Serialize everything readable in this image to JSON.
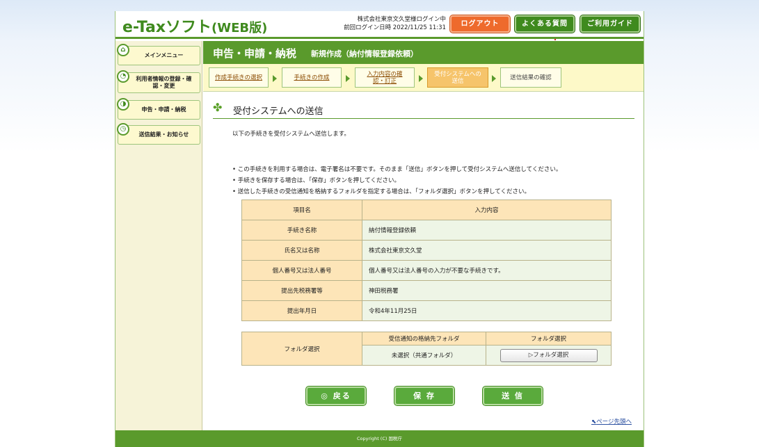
{
  "header": {
    "logo_main": "e-Taxソフト",
    "logo_version": "(WEB版)",
    "user_line": "株式会社東京文久堂様ログイン中",
    "last_login_label": "前回ログイン日時",
    "last_login_value": "2022/11/25 11:31",
    "logout_label": "ログアウト",
    "faq_label": "よくある質問",
    "guide_label": "ご利用ガイド"
  },
  "sidebar": {
    "items": [
      {
        "label": "メインメニュー",
        "icon": "home-icon"
      },
      {
        "label": "利用者情報の登録・確認・変更",
        "icon": "user-icon"
      },
      {
        "label": "申告・申請・納税",
        "icon": "document-icon"
      },
      {
        "label": "送信結果・お知らせ",
        "icon": "clock-icon"
      }
    ]
  },
  "page": {
    "title": "申告・申請・納税",
    "subtitle": "新規作成（納付情報登録依頼）"
  },
  "steps": [
    {
      "label": "作成手続きの選択"
    },
    {
      "label": "手続きの作成"
    },
    {
      "label": "入力内容の確認・訂正"
    },
    {
      "label": "受付システムへの送信"
    },
    {
      "label": "送信結果の確認"
    }
  ],
  "section": {
    "title": "受付システムへの送信",
    "intro": "以下の手続きを受付システムへ送信します。",
    "bullets": [
      "この手続きを利用する場合は、電子署名は不要です。そのまま「送信」ボタンを押して受付システムへ送信してください。",
      "手続きを保存する場合は、「保存」ボタンを押してください。",
      "送信した手続きの受信通知を格納するフォルダを指定する場合は、「フォルダ選択」ボタンを押してください。"
    ]
  },
  "info_table": {
    "header": {
      "key": "項目名",
      "value": "入力内容"
    },
    "rows": [
      {
        "key": "手続き名称",
        "value": "納付情報登録依頼"
      },
      {
        "key": "氏名又は名称",
        "value": "株式会社東京文久堂"
      },
      {
        "key": "個人番号又は法人番号",
        "value": "個人番号又は法人番号の入力が不要な手続きです。"
      },
      {
        "key": "提出先税務署等",
        "value": "神田税務署"
      },
      {
        "key": "提出年月日",
        "value": "令和4年11月25日"
      }
    ]
  },
  "folder_table": {
    "label": "フォルダ選択",
    "col_folder": "受信通知の格納先フォルダ",
    "col_select": "フォルダ選択",
    "folder_value": "未選択（共通フォルダ）",
    "button_label": "▷フォルダ選択"
  },
  "actions": {
    "back_label": "◎ 戻る",
    "save_label": "保 存",
    "send_label": "送 信"
  },
  "page_top_label": "ページ先頭へ",
  "footer": {
    "copyright": "Copyright (C) 国税庁"
  }
}
